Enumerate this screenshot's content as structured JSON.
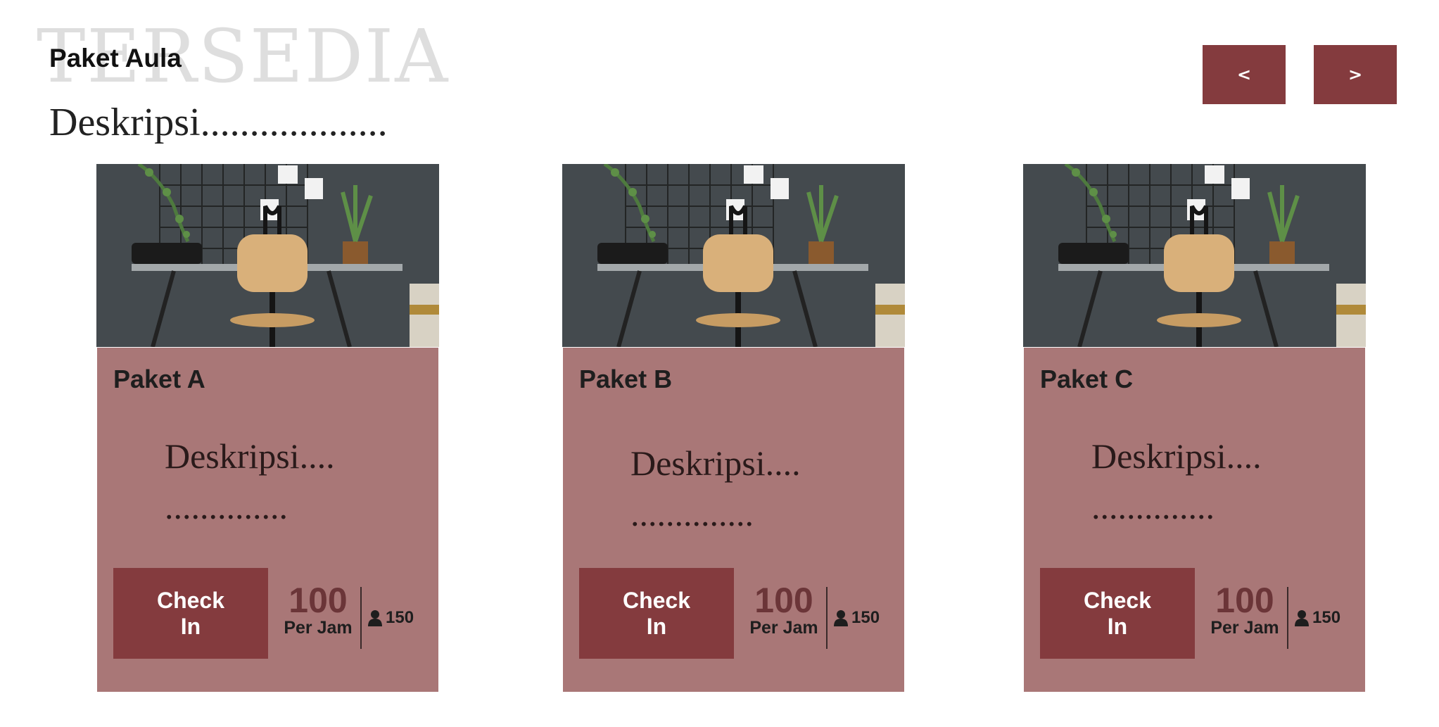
{
  "header": {
    "watermark": "TERSEDIA",
    "title": "Paket Aula",
    "description": "Deskripsi..................."
  },
  "nav": {
    "prev_label": "<",
    "next_label": ">"
  },
  "colors": {
    "accent": "#843b3e",
    "card_background": "#a97777",
    "price_text": "#6b3538"
  },
  "cards": [
    {
      "name": "Paket A",
      "description_line1": "Deskripsi....",
      "description_line2": "..............",
      "checkin_label": "Check In",
      "price": "100",
      "price_unit": "Per Jam",
      "capacity_icon": "person-icon",
      "capacity": "150"
    },
    {
      "name": "Paket B",
      "description_line1": "Deskripsi....",
      "description_line2": "..............",
      "checkin_label": "Check In",
      "price": "100",
      "price_unit": "Per Jam",
      "capacity_icon": "person-icon",
      "capacity": "150"
    },
    {
      "name": "Paket C",
      "description_line1": "Deskripsi....",
      "description_line2": "..............",
      "checkin_label": "Check In",
      "price": "100",
      "price_unit": "Per Jam",
      "capacity_icon": "person-icon",
      "capacity": "150"
    }
  ]
}
